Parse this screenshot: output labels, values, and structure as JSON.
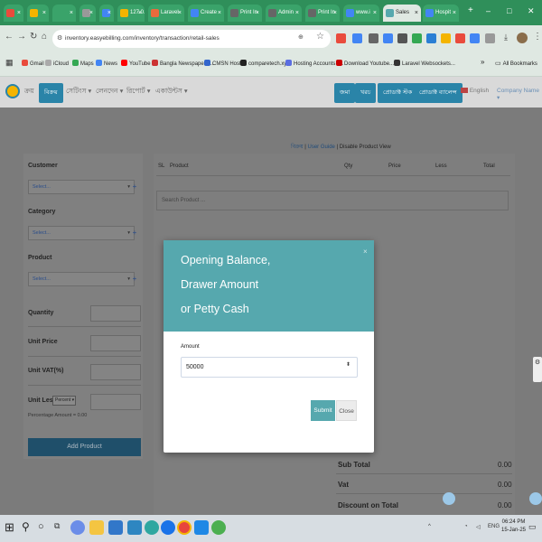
{
  "browser": {
    "tabs": [
      {
        "label": "",
        "color": "#e94b3c"
      },
      {
        "label": "",
        "color": "#f4b400"
      },
      {
        "label": "",
        "color": "#3aa36a"
      },
      {
        "label": "",
        "color": "#999999"
      },
      {
        "label": "",
        "color": "#4285f4"
      },
      {
        "label": "127.0.0",
        "color": "#f4b400"
      },
      {
        "label": "Laravel",
        "color": "#e96a3c"
      },
      {
        "label": "Create",
        "color": "#4285f4"
      },
      {
        "label": "Print In",
        "color": "#666666"
      },
      {
        "label": "Admin",
        "color": "#666666"
      },
      {
        "label": "Print In",
        "color": "#666666"
      },
      {
        "label": "www.i",
        "color": "#4285f4"
      },
      {
        "label": "Sales",
        "color": "#56a8ae"
      },
      {
        "label": "Hospit",
        "color": "#4285f4"
      }
    ],
    "new_tab": "+",
    "url": "inventory.easyebilling.com/inventory/transaction/retail-sales",
    "window_controls": {
      "minimize": "–",
      "maximize": "□",
      "close": "✕"
    },
    "bookmarks": [
      {
        "label": "Gmail",
        "color": "#e94b3c"
      },
      {
        "label": "iCloud",
        "color": "#aaaaaa"
      },
      {
        "label": "Maps",
        "color": "#34a853"
      },
      {
        "label": "News",
        "color": "#4285f4"
      },
      {
        "label": "YouTube",
        "color": "#ff0000"
      },
      {
        "label": "Bangla Newspaper :...",
        "color": "#cc3333"
      },
      {
        "label": "CMSN Host",
        "color": "#3366cc"
      },
      {
        "label": "comparetech.xyz",
        "color": "#222222"
      },
      {
        "label": "Hosting Accounts -...",
        "color": "#5b6ee1"
      },
      {
        "label": "Download Youtube...",
        "color": "#cc0000"
      },
      {
        "label": "Laravel Websockets...",
        "color": "#333333"
      }
    ],
    "bookmarks_overflow": "»",
    "all_bookmarks": "All Bookmarks"
  },
  "nav": {
    "items": [
      "ক্রয়",
      "বিক্রয়",
      "সেটিংস",
      "লেনদেন",
      "রিপোর্ট",
      "একাউন্টস"
    ],
    "right_buttons": [
      "জমা",
      "খরচ",
      "প্রোডাক্ট স্টক",
      "প্রোডাক্ট ব্যালেন্স"
    ],
    "language": "English",
    "company": "Company Name"
  },
  "page": {
    "title": "বিক্রয়",
    "separator": "|",
    "user_guide": "User Guide",
    "disable_view": "Disable Product View"
  },
  "form": {
    "customer_label": "Customer",
    "customer_select": "Select...",
    "category_label": "Category",
    "category_select": "Select...",
    "product_label": "Product",
    "product_select": "Select...",
    "quantity_label": "Quantity",
    "unit_price_label": "Unit Price",
    "unit_vat_label": "Unit VAT(%)",
    "unit_less_label": "Unit Less",
    "unit_less_type": "Percent",
    "percentage_amount": "Percentage Amount = 0.00",
    "add_product": "Add Product"
  },
  "table": {
    "headers": [
      "SL",
      "Product",
      "Qty",
      "Price",
      "Less",
      "Total"
    ],
    "search_placeholder": "Search Product ..."
  },
  "totals": {
    "sub_total_label": "Sub Total",
    "sub_total": "0.00",
    "vat_label": "Vat",
    "vat": "0.00",
    "discount_label": "Discount on Total",
    "discount": "0.00"
  },
  "modal": {
    "title_line1": "Opening Balance,",
    "title_line2": "Drawer Amount",
    "title_line3": "or Petty Cash",
    "close_x": "×",
    "amount_label": "Amount",
    "amount_value": "50000",
    "submit": "Submit",
    "close": "Close"
  },
  "taskbar": {
    "time": "06:24 PM",
    "date": "15-Jan-25",
    "language": "ENG"
  }
}
